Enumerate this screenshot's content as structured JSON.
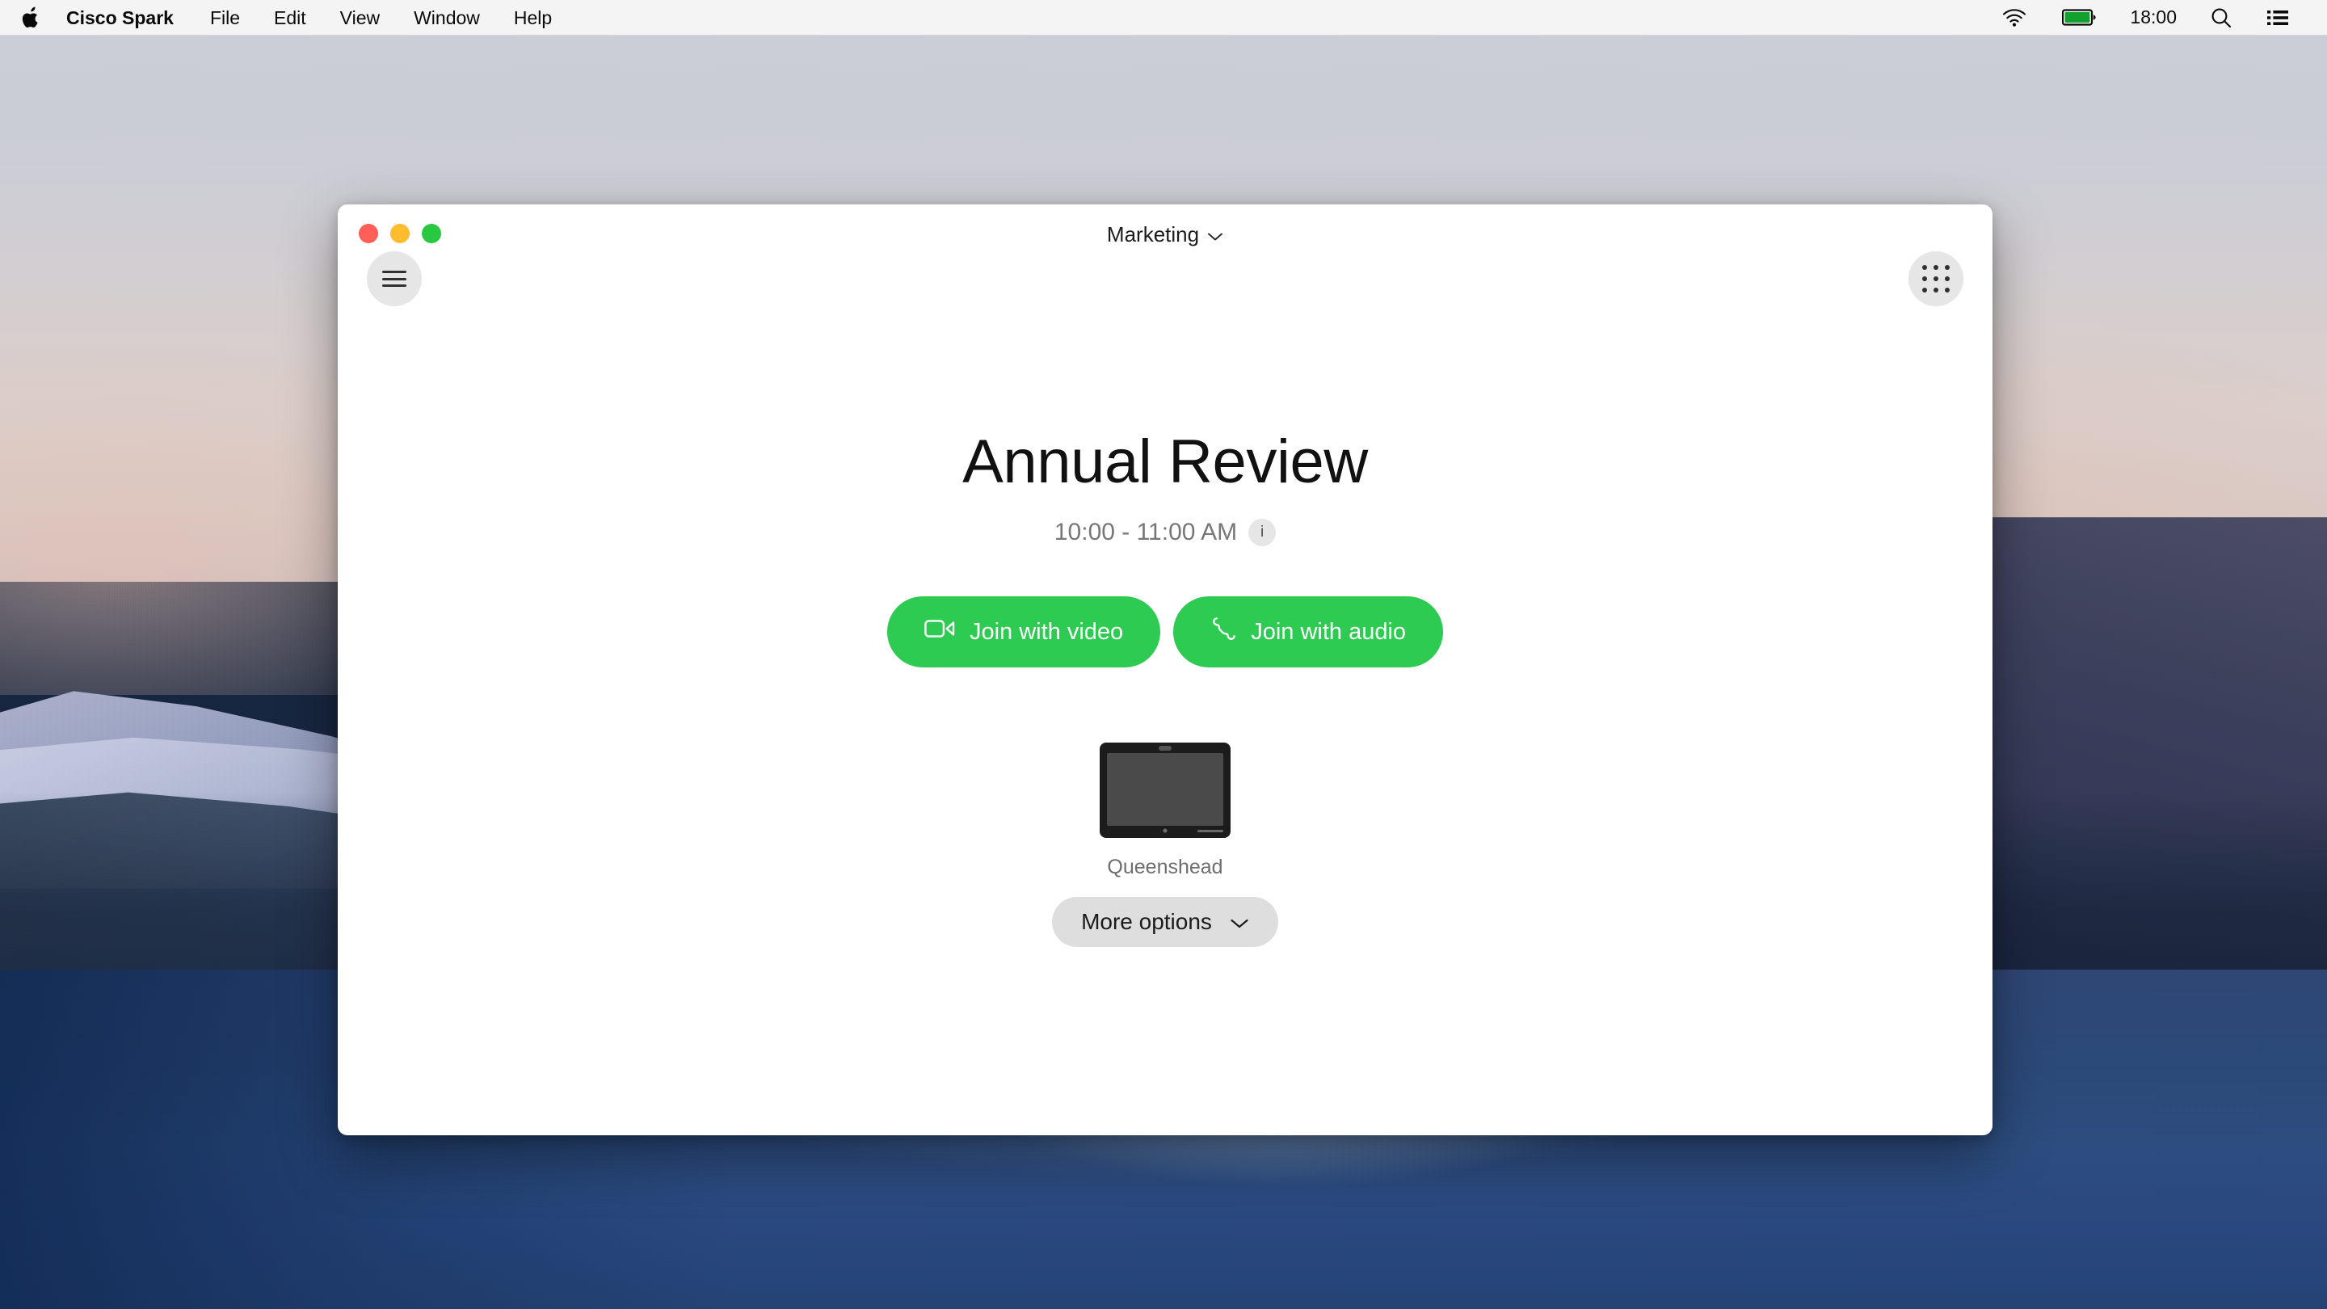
{
  "menubar": {
    "apple_icon": "apple-logo-icon",
    "app_name": "Cisco Spark",
    "items": [
      "File",
      "Edit",
      "View",
      "Window",
      "Help"
    ],
    "status_icons": [
      "wifi-icon",
      "battery-icon",
      "search-icon",
      "notification-center-icon"
    ],
    "clock": "18:00",
    "battery_color": "#12a12f"
  },
  "window": {
    "traffic_lights": [
      "close-button",
      "minimize-button",
      "zoom-button"
    ],
    "traffic_colors": {
      "close": "#ff5f57",
      "minimize": "#febc2e",
      "zoom": "#28c840"
    },
    "title": "Marketing",
    "title_chevron": "chevron-down-icon",
    "menu_icon": "hamburger-menu-icon",
    "grid_icon": "app-grid-icon"
  },
  "meeting": {
    "title": "Annual Review",
    "time": "10:00 - 11:00 AM",
    "info_badge": "i",
    "info_badge_name": "meeting-info-icon"
  },
  "actions": {
    "join_video_label": "Join with video",
    "join_video_icon": "video-camera-icon",
    "join_audio_label": "Join with audio",
    "join_audio_icon": "phone-handset-icon",
    "button_color": "#2ecb52"
  },
  "device": {
    "icon": "display-device-icon",
    "name": "Queenshead",
    "more_options_label": "More options",
    "more_options_icon": "chevron-down-icon"
  }
}
